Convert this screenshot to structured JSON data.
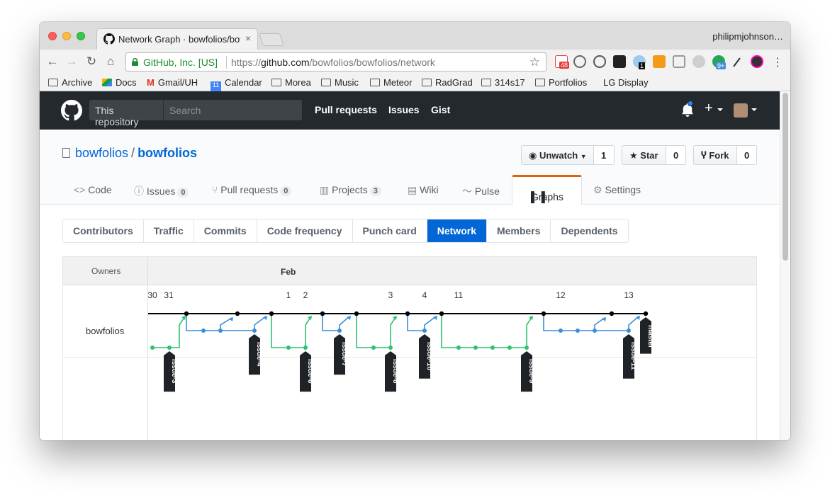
{
  "browser": {
    "tab_title": "Network Graph · bowfolios/bowfolios",
    "tab_close": "×",
    "profile_name": "philipmjohnson…",
    "ev_label": "GitHub, Inc. [US]",
    "url_scheme": "https://",
    "url_host": "github.com",
    "url_path": "/bowfolios/bowfolios/network",
    "bookmarks": [
      "Archive",
      "Docs",
      "Gmail/UH",
      "Calendar",
      "Morea",
      "Music",
      "Meteor",
      "RadGrad",
      "314s17",
      "Portfolios",
      "LG Display"
    ],
    "calendar_badge": "11",
    "ext_badges": [
      "48",
      "1",
      "9+"
    ]
  },
  "github_header": {
    "scope": "This repository",
    "search_placeholder": "Search",
    "nav": [
      "Pull requests",
      "Issues",
      "Gist"
    ],
    "plus": "+"
  },
  "repo": {
    "owner": "bowfolios",
    "separator": "/",
    "name": "bowfolios",
    "unwatch_label": "Unwatch",
    "watch_count": "1",
    "star_label": "Star",
    "star_count": "0",
    "fork_label": "Fork",
    "fork_count": "0",
    "tabs": {
      "code": "Code",
      "issues": "Issues",
      "issues_count": "0",
      "pulls": "Pull requests",
      "pulls_count": "0",
      "projects": "Projects",
      "projects_count": "3",
      "wiki": "Wiki",
      "pulse": "Pulse",
      "graphs": "Graphs",
      "settings": "Settings"
    }
  },
  "graph_nav": {
    "items": [
      "Contributors",
      "Traffic",
      "Commits",
      "Code frequency",
      "Punch card",
      "Network",
      "Members",
      "Dependents"
    ],
    "active": "Network"
  },
  "network": {
    "owners_label": "Owners",
    "month": "Feb",
    "owner": "bowfolios",
    "day_labels": [
      {
        "text": "30"
      },
      {
        "text": "31"
      },
      {
        "text": "1"
      },
      {
        "text": "2"
      },
      {
        "text": "3"
      },
      {
        "text": "4"
      },
      {
        "text": "11"
      },
      {
        "text": "12"
      },
      {
        "text": "13"
      }
    ],
    "branch_labels": [
      "issue-3",
      "issue-4",
      "issue-6",
      "issue-7",
      "issue-8",
      "issue-10",
      "issue-9",
      "issue-11",
      "master"
    ],
    "colors": {
      "master": "#000000",
      "feature": "#3a8ed8",
      "fix": "#2bc36b",
      "label_bg": "#1f2328"
    }
  }
}
